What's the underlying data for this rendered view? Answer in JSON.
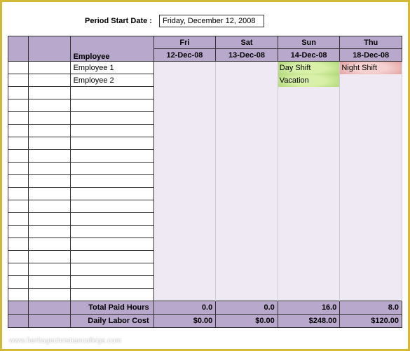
{
  "period": {
    "label": "Period Start Date :",
    "value": "Friday, December 12, 2008"
  },
  "header": {
    "employee": "Employee",
    "days": [
      {
        "dow": "Fri",
        "date": "12-Dec-08"
      },
      {
        "dow": "Sat",
        "date": "13-Dec-08"
      },
      {
        "dow": "Sun",
        "date": "14-Dec-08"
      },
      {
        "dow": "Thu",
        "date": "18-Dec-08"
      }
    ]
  },
  "rows": [
    {
      "employee": "Employee 1",
      "cells": [
        "",
        "",
        {
          "text": "Day Shift",
          "style": "green"
        },
        {
          "text": "Night Shift",
          "style": "red"
        }
      ]
    },
    {
      "employee": "Employee 2",
      "cells": [
        "",
        "",
        {
          "text": "Vacation",
          "style": "green"
        },
        ""
      ]
    },
    {
      "employee": "",
      "cells": [
        "",
        "",
        "",
        ""
      ]
    },
    {
      "employee": "",
      "cells": [
        "",
        "",
        "",
        ""
      ]
    },
    {
      "employee": "",
      "cells": [
        "",
        "",
        "",
        ""
      ]
    },
    {
      "employee": "",
      "cells": [
        "",
        "",
        "",
        ""
      ]
    },
    {
      "employee": "",
      "cells": [
        "",
        "",
        "",
        ""
      ]
    },
    {
      "employee": "",
      "cells": [
        "",
        "",
        "",
        ""
      ]
    },
    {
      "employee": "",
      "cells": [
        "",
        "",
        "",
        ""
      ]
    },
    {
      "employee": "",
      "cells": [
        "",
        "",
        "",
        ""
      ]
    },
    {
      "employee": "",
      "cells": [
        "",
        "",
        "",
        ""
      ]
    },
    {
      "employee": "",
      "cells": [
        "",
        "",
        "",
        ""
      ]
    },
    {
      "employee": "",
      "cells": [
        "",
        "",
        "",
        ""
      ]
    },
    {
      "employee": "",
      "cells": [
        "",
        "",
        "",
        ""
      ]
    },
    {
      "employee": "",
      "cells": [
        "",
        "",
        "",
        ""
      ]
    },
    {
      "employee": "",
      "cells": [
        "",
        "",
        "",
        ""
      ]
    },
    {
      "employee": "",
      "cells": [
        "",
        "",
        "",
        ""
      ]
    },
    {
      "employee": "",
      "cells": [
        "",
        "",
        "",
        ""
      ]
    },
    {
      "employee": "",
      "cells": [
        "",
        "",
        "",
        ""
      ]
    }
  ],
  "footer": {
    "totalHoursLabel": "Total Paid Hours",
    "totalHours": [
      "0.0",
      "0.0",
      "16.0",
      "8.0"
    ],
    "laborCostLabel": "Daily Labor Cost",
    "laborCost": [
      "$0.00",
      "$0.00",
      "$248.00",
      "$120.00"
    ]
  },
  "watermark": "www.heritagechristiancollege.com"
}
